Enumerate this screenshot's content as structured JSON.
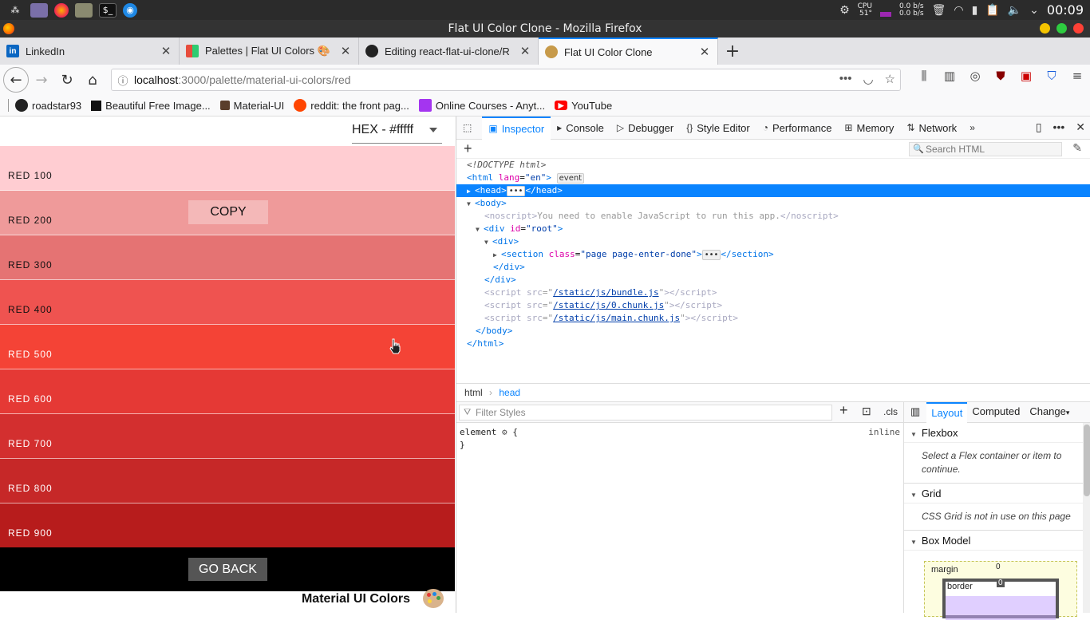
{
  "taskbar": {
    "cpu_label": "CPU",
    "cpu_temp": "51°",
    "net_up": "0.0 b/s",
    "net_down": "0.0 b/s",
    "clock": "00:09"
  },
  "window": {
    "title": "Flat UI Color Clone - Mozilla Firefox"
  },
  "tabs": [
    {
      "label": "LinkedIn",
      "color": "#0a66c2",
      "glyph": "in"
    },
    {
      "label": "Palettes | Flat UI Colors 🎨",
      "color": "#e74c3c",
      "glyph": "■"
    },
    {
      "label": "Editing react-flat-ui-clone/R",
      "color": "#222222",
      "glyph": "●"
    },
    {
      "label": "Flat UI Color Clone",
      "color": "#c79a4a",
      "glyph": "●"
    }
  ],
  "url": {
    "host": "localhost",
    "path": ":3000/palette/material-ui-colors/red"
  },
  "bookmarks": [
    {
      "label": "roadstar93",
      "color": "#222222"
    },
    {
      "label": "Beautiful Free Image...",
      "color": "#111111"
    },
    {
      "label": "Material-UI",
      "color": "#5a3e2b"
    },
    {
      "label": "reddit: the front pag...",
      "color": "#ff4500"
    },
    {
      "label": "Online Courses - Anyt...",
      "color": "#a435f0"
    },
    {
      "label": "YouTube",
      "color": "#ff0000"
    }
  ],
  "palette": {
    "format_select": "HEX - #fffff",
    "copy_label": "COPY",
    "go_back_label": "GO BACK",
    "footer_title": "Material UI Colors",
    "swatches": [
      {
        "name": "RED 100",
        "color": "#ffcdd2"
      },
      {
        "name": "RED 200",
        "color": "#ef9a9a"
      },
      {
        "name": "RED 300",
        "color": "#e57373"
      },
      {
        "name": "RED 400",
        "color": "#ef5350"
      },
      {
        "name": "RED 500",
        "color": "#f44336"
      },
      {
        "name": "RED 600",
        "color": "#e53935"
      },
      {
        "name": "RED 700",
        "color": "#d32f2f"
      },
      {
        "name": "RED 800",
        "color": "#c62828"
      },
      {
        "name": "RED 900",
        "color": "#b71c1c"
      }
    ]
  },
  "devtools": {
    "tabs": [
      "Inspector",
      "Console",
      "Debugger",
      "Style Editor",
      "Performance",
      "Memory",
      "Network"
    ],
    "search_placeholder": "Search HTML",
    "markup": {
      "doctype": "<!DOCTYPE html>",
      "html_open": "html",
      "lang_attr": "lang",
      "lang_val": "\"en\"",
      "event_badge": "event",
      "head": "head",
      "body": "body",
      "noscript_text": "You need to enable JavaScript to run this app.",
      "div": "div",
      "id_attr": "id",
      "root_val": "\"root\"",
      "section": "section",
      "class_attr": "class",
      "section_class": "\"page page-enter-done\"",
      "script": "script",
      "src_attr": "src",
      "scripts": [
        "/static/js/bundle.js",
        "/static/js/0.chunk.js",
        "/static/js/main.chunk.js"
      ]
    },
    "breadcrumbs": [
      "html",
      "head"
    ],
    "filter_placeholder": "Filter Styles",
    "cls_label": ".cls",
    "rule_selector": "element",
    "rule_origin": "inline",
    "side_tabs": [
      "Layout",
      "Computed",
      "Change"
    ],
    "sections": {
      "flexbox_title": "Flexbox",
      "flexbox_text": "Select a Flex container or item to continue.",
      "grid_title": "Grid",
      "grid_text": "CSS Grid is not in use on this page",
      "boxmodel_title": "Box Model",
      "margin_label": "margin",
      "border_label": "border",
      "margin_value": "0",
      "border_value": "0"
    }
  }
}
